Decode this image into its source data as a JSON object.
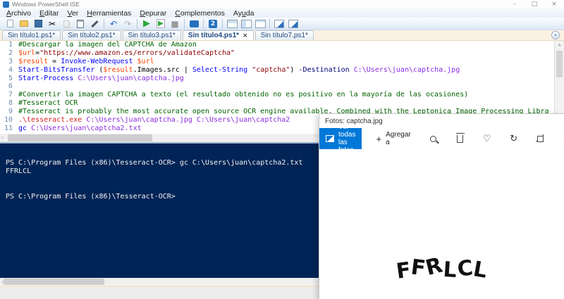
{
  "window": {
    "title": "Windows PowerShell ISE",
    "controls": [
      {
        "name": "minimize",
        "glyph": "–"
      },
      {
        "name": "maximize",
        "glyph": "□"
      },
      {
        "name": "close",
        "glyph": "×"
      }
    ]
  },
  "menu": {
    "items": [
      {
        "label": "Archivo",
        "accel": 0
      },
      {
        "label": "Editar",
        "accel": 0
      },
      {
        "label": "Ver",
        "accel": 0
      },
      {
        "label": "Herramientas",
        "accel": 0
      },
      {
        "label": "Depurar",
        "accel": 0
      },
      {
        "label": "Complementos",
        "accel": 0
      },
      {
        "label": "Ayuda",
        "accel": 2
      }
    ]
  },
  "toolbar": {
    "icons": [
      {
        "name": "new-script-icon",
        "kind": "page"
      },
      {
        "name": "open-script-icon",
        "kind": "folder"
      },
      {
        "name": "save-icon",
        "kind": "floppy"
      },
      {
        "name": "cut-icon",
        "kind": "glyph",
        "glyph": "✂",
        "cls": ""
      },
      {
        "name": "copy-icon",
        "kind": "copy"
      },
      {
        "name": "paste-icon",
        "kind": "clip"
      },
      {
        "name": "clear-console-icon",
        "kind": "wrench"
      },
      {
        "name": "sep"
      },
      {
        "name": "undo-icon",
        "kind": "glyph",
        "glyph": "↶",
        "cls": "g-undo"
      },
      {
        "name": "redo-icon",
        "kind": "glyph",
        "glyph": "↷",
        "cls": "g-redo"
      },
      {
        "name": "sep"
      },
      {
        "name": "run-script-icon",
        "kind": "glyph",
        "glyph": "▶",
        "cls": "g-run"
      },
      {
        "name": "run-selection-icon",
        "kind": "glyph",
        "glyph": "▶",
        "cls": "g-runsel"
      },
      {
        "name": "stop-icon",
        "kind": "glyph",
        "glyph": "■",
        "cls": "g-stop"
      },
      {
        "name": "sep"
      },
      {
        "name": "new-remote-tab-icon",
        "kind": "remote"
      },
      {
        "name": "sep"
      },
      {
        "name": "start-powershell-icon",
        "kind": "ps",
        "glyph": "2"
      },
      {
        "name": "sep"
      },
      {
        "name": "layout-split-horizontal-icon",
        "kind": "layout",
        "cls": "lay-h"
      },
      {
        "name": "layout-split-vertical-icon",
        "kind": "layout",
        "cls": "lay-v"
      },
      {
        "name": "layout-script-maximized-icon",
        "kind": "layout",
        "cls": "lay-f"
      },
      {
        "name": "sep"
      },
      {
        "name": "show-script-pane-top-icon",
        "kind": "badge"
      },
      {
        "name": "show-script-pane-right-icon",
        "kind": "badge"
      }
    ]
  },
  "tabs": [
    {
      "label": "Sin título1.ps1*",
      "active": false
    },
    {
      "label": "Sin título2.ps1*",
      "active": false
    },
    {
      "label": "Sin título3.ps1*",
      "active": false
    },
    {
      "label": "Sin título4.ps1*",
      "active": true,
      "close_glyph": "×"
    },
    {
      "label": "Sin título7.ps1*",
      "active": false
    }
  ],
  "editor": {
    "colors": {
      "comment": "#006400",
      "variable": "#ff4500",
      "string": "#8b0000",
      "cmdlet": "#0000ff",
      "parameter": "#000080",
      "argument": "#8a2be2",
      "plain": "#000000",
      "command": "#e02020"
    },
    "lines": [
      {
        "n": "1",
        "segments": [
          {
            "t": "#Descargar la imagen del CAPTCHA de Amazon",
            "c": "comment"
          }
        ]
      },
      {
        "n": "2",
        "segments": [
          {
            "t": "$url",
            "c": "variable"
          },
          {
            "t": "=",
            "c": "plain"
          },
          {
            "t": "\"https://www.amazon.es/errors/validateCaptcha\"",
            "c": "string"
          }
        ]
      },
      {
        "n": "3",
        "segments": [
          {
            "t": "$result",
            "c": "variable"
          },
          {
            "t": " = ",
            "c": "plain"
          },
          {
            "t": "Invoke-WebRequest",
            "c": "cmdlet"
          },
          {
            "t": " ",
            "c": "plain"
          },
          {
            "t": "$url",
            "c": "variable"
          }
        ]
      },
      {
        "n": "4",
        "segments": [
          {
            "t": "Start-BitsTransfer",
            "c": "cmdlet"
          },
          {
            "t": " (",
            "c": "plain"
          },
          {
            "t": "$result",
            "c": "variable"
          },
          {
            "t": ".Images.src | ",
            "c": "plain"
          },
          {
            "t": "Select-String",
            "c": "cmdlet"
          },
          {
            "t": " ",
            "c": "plain"
          },
          {
            "t": "\"captcha\"",
            "c": "string"
          },
          {
            "t": ") ",
            "c": "plain"
          },
          {
            "t": "-Destination",
            "c": "parameter"
          },
          {
            "t": " ",
            "c": "plain"
          },
          {
            "t": "C:\\Users\\juan\\captcha.jpg",
            "c": "argument"
          }
        ]
      },
      {
        "n": "5",
        "segments": [
          {
            "t": "Start-Process",
            "c": "cmdlet"
          },
          {
            "t": " ",
            "c": "plain"
          },
          {
            "t": "C:\\Users\\juan\\captcha.jpg",
            "c": "argument"
          }
        ]
      },
      {
        "n": "6",
        "segments": []
      },
      {
        "n": "7",
        "segments": [
          {
            "t": "#Convertir la imagen CAPTCHA a texto (el resultado obtenido no es positivo en la mayoría de las ocasiones)",
            "c": "comment"
          }
        ]
      },
      {
        "n": "8",
        "segments": [
          {
            "t": "#Tesseract OCR",
            "c": "comment"
          }
        ]
      },
      {
        "n": "9",
        "segments": [
          {
            "t": "#Tesseract is probably the most accurate open source OCR engine available. Combined with the Leptonica Image Processing Libra",
            "c": "comment"
          }
        ]
      },
      {
        "n": "10",
        "segments": [
          {
            "t": ".\\tesseract.exe",
            "c": "command"
          },
          {
            "t": " ",
            "c": "plain"
          },
          {
            "t": "C:\\Users\\juan\\captcha.jpg C:\\Users\\juan\\captcha2",
            "c": "argument"
          }
        ]
      },
      {
        "n": "11",
        "segments": [
          {
            "t": "gc",
            "c": "cmdlet"
          },
          {
            "t": " ",
            "c": "plain"
          },
          {
            "t": "C:\\Users\\juan\\captcha2.txt",
            "c": "argument"
          }
        ]
      }
    ]
  },
  "console": {
    "lines": [
      "PS C:\\Program Files (x86)\\Tesseract-OCR> gc C:\\Users\\juan\\captcha2.txt",
      "FFRLCL",
      "",
      "",
      "PS C:\\Program Files (x86)\\Tesseract-OCR> "
    ]
  },
  "photos": {
    "title": "Fotos: captcha.jpg",
    "view_all_label": "Ver todas las fotos",
    "add_label": "Agregar a",
    "add_plus_glyph": "+",
    "icons": [
      {
        "name": "zoom-icon",
        "kind": "mag"
      },
      {
        "name": "delete-icon",
        "kind": "trash"
      },
      {
        "name": "favorite-icon",
        "kind": "glyph",
        "glyph": "♡"
      },
      {
        "name": "rotate-icon",
        "kind": "glyph",
        "glyph": "↻"
      },
      {
        "name": "crop-icon",
        "kind": "crop"
      },
      {
        "name": "edit-icon",
        "kind": "glyph",
        "glyph": "✂"
      }
    ],
    "captcha_text": "FFRLCL"
  },
  "scrollbars": {
    "up_glyph": "∧",
    "left_glyph": "‹"
  }
}
